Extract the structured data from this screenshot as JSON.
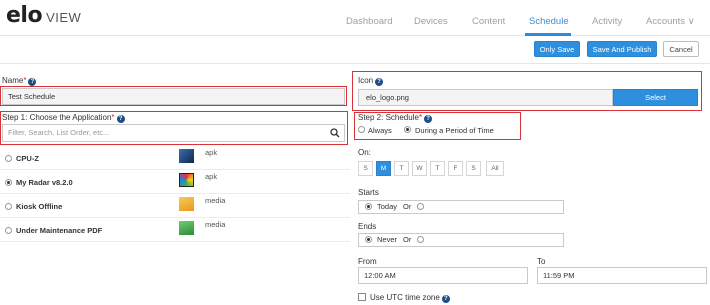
{
  "app": {
    "logo_main": "elo",
    "logo_sub": "VIEW"
  },
  "nav": {
    "tabs": [
      "Dashboard",
      "Devices",
      "Content",
      "Schedule",
      "Activity",
      "Accounts ∨"
    ],
    "active": "Schedule"
  },
  "actions": {
    "only_save": "Only Save",
    "save_publish": "Save And Publish",
    "cancel": "Cancel"
  },
  "name": {
    "label": "Name",
    "required": "*",
    "value": "Test Schedule"
  },
  "icon": {
    "label": "Icon",
    "file": "elo_logo.png",
    "select": "Select"
  },
  "step1": {
    "label": "Step 1: Choose the Application",
    "required": "*",
    "search_placeholder": "Filter, Search, List Order, etc...",
    "apps": [
      {
        "name": "CPU-Z",
        "type": "apk",
        "selected": false,
        "thumb_color": "#1d3c73"
      },
      {
        "name": "My Radar v8.2.0",
        "type": "apk",
        "selected": true,
        "thumb_color": "#2a2a2a"
      },
      {
        "name": "Kiosk Offline",
        "type": "media",
        "selected": false,
        "thumb_color": "#f0b53a"
      },
      {
        "name": "Under Maintenance PDF",
        "type": "media",
        "selected": false,
        "thumb_color": "#4caf50"
      }
    ]
  },
  "step2": {
    "label": "Step 2: Schedule",
    "required": "*",
    "options": [
      "Always",
      "During a Period of Time"
    ],
    "selected": "During a Period of Time"
  },
  "on": {
    "label": "On:",
    "days": [
      "S",
      "M",
      "T",
      "W",
      "T",
      "F",
      "S",
      "All"
    ],
    "active_index": 1
  },
  "starts": {
    "label": "Starts",
    "value": "Today",
    "or_text": "Or"
  },
  "ends": {
    "label": "Ends",
    "value": "Never",
    "or_text": "Or"
  },
  "from": {
    "label": "From",
    "value": "12:00 AM"
  },
  "to": {
    "label": "To",
    "value": "11:59 PM"
  },
  "utc": {
    "label": "Use UTC time zone",
    "checked": false
  },
  "colors": {
    "accent": "#2f8fdf",
    "highlight": "#d8333a"
  }
}
